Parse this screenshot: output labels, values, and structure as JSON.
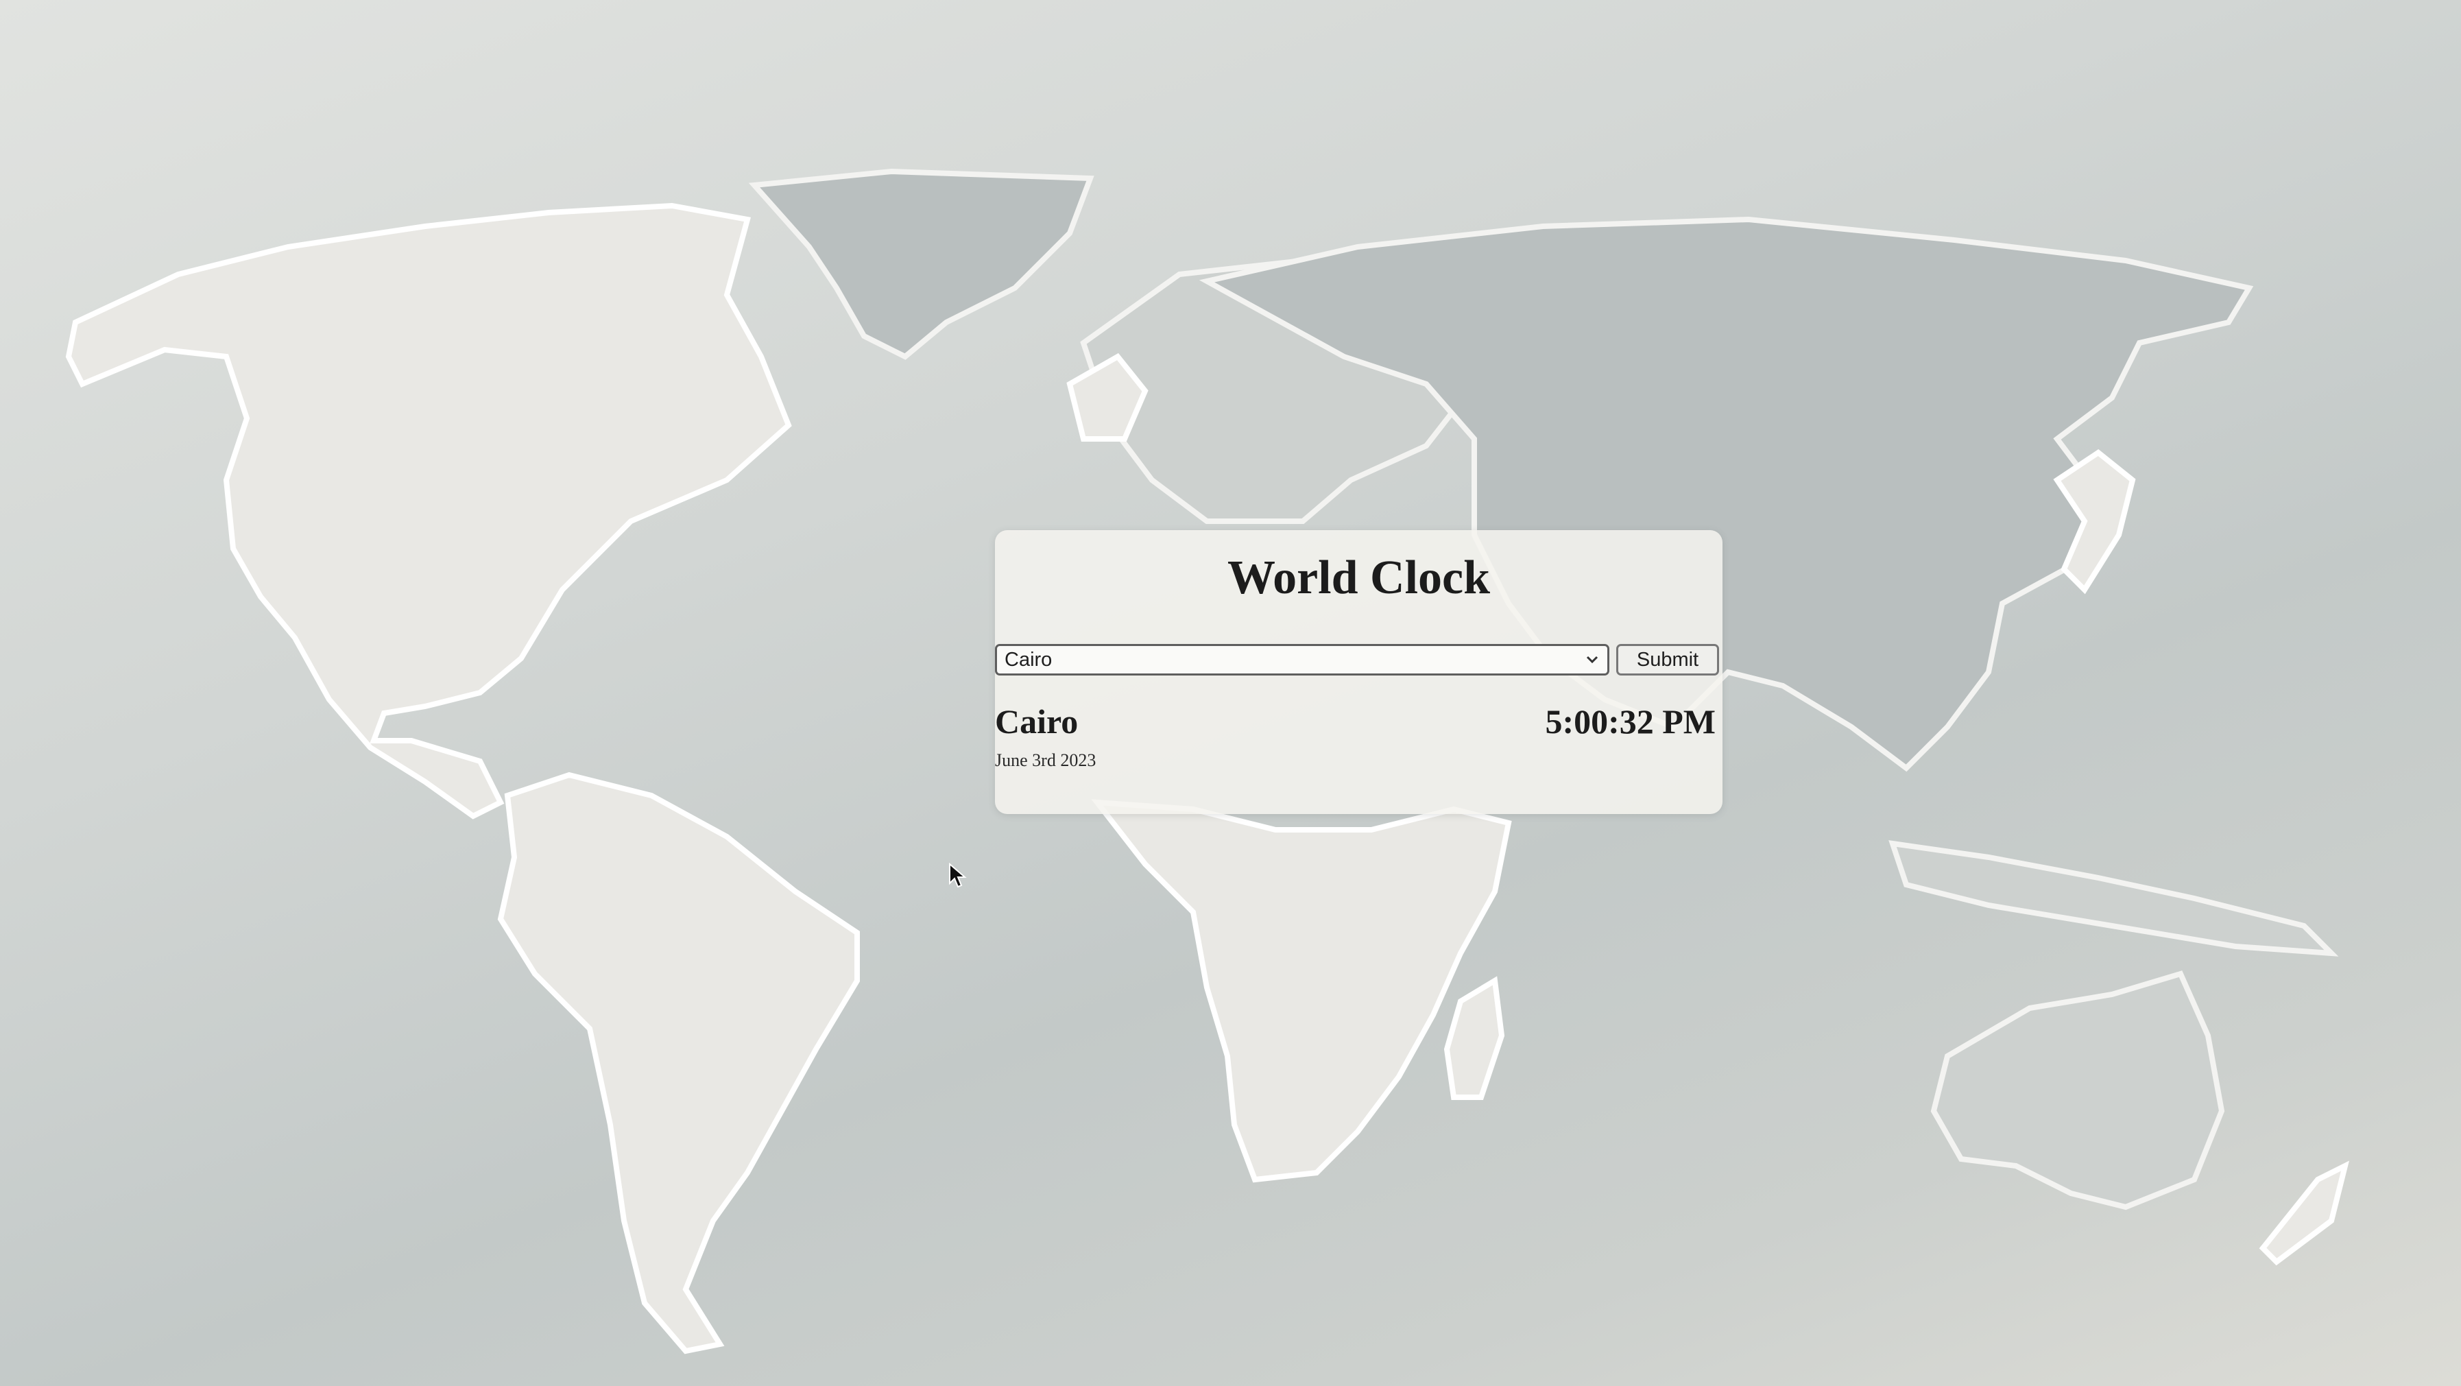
{
  "app": {
    "title": "World Clock"
  },
  "selector": {
    "selected_city": "Cairo",
    "submit_label": "Submit"
  },
  "result": {
    "city": "Cairo",
    "date": "June 3rd 2023",
    "time": "5:00:32 PM"
  },
  "icons": {
    "dropdown": "chevron-down-icon",
    "pointer": "mouse-cursor-icon"
  },
  "colors": {
    "background": "#d2d6d4",
    "panel": "#f4f3ef",
    "text": "#1c1c1c"
  }
}
